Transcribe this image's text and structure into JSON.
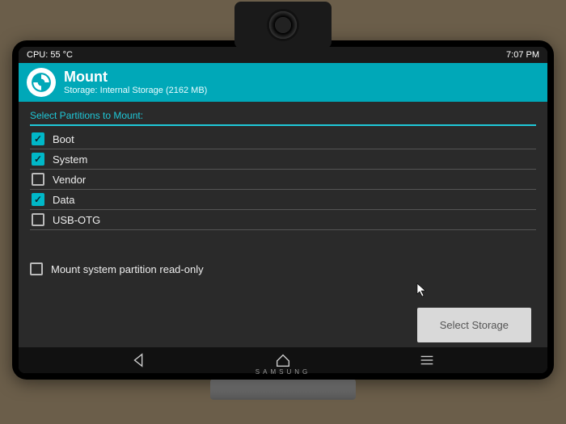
{
  "statusbar": {
    "cpu": "CPU: 55 °C",
    "time": "7:07 PM"
  },
  "header": {
    "title": "Mount",
    "subtitle": "Storage: Internal Storage (2162 MB)"
  },
  "section_label": "Select Partitions to Mount:",
  "partitions": [
    {
      "label": "Boot",
      "checked": true
    },
    {
      "label": "System",
      "checked": true
    },
    {
      "label": "Vendor",
      "checked": false
    },
    {
      "label": "Data",
      "checked": true
    },
    {
      "label": "USB-OTG",
      "checked": false
    }
  ],
  "readonly": {
    "label": "Mount system partition read-only",
    "checked": false
  },
  "select_storage_label": "Select Storage",
  "monitor_brand": "SAMSUNG"
}
